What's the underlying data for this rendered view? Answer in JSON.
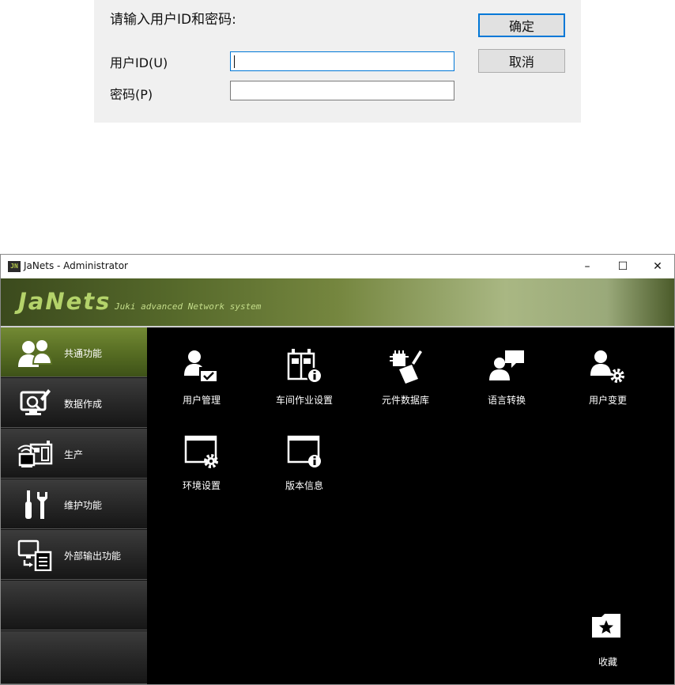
{
  "login": {
    "prompt": "请输入用户ID和密码:",
    "user_id_label": "用户ID(U)",
    "password_label": "密码(P)",
    "user_id_value": "",
    "password_value": "",
    "ok_label": "确定",
    "cancel_label": "取消"
  },
  "window": {
    "title": "JaNets - Administrator",
    "app_icon_text": "JN",
    "controls": {
      "minimize": "–",
      "maximize": "☐",
      "close": "✕"
    }
  },
  "banner": {
    "logo": "JaNets",
    "tagline": "Juki advanced Network system"
  },
  "sidebar": {
    "items": [
      {
        "label": "共通功能",
        "icon": "users-icon",
        "active": true
      },
      {
        "label": "数据作成",
        "icon": "data-edit-icon",
        "active": false
      },
      {
        "label": "生产",
        "icon": "production-icon",
        "active": false
      },
      {
        "label": "维护功能",
        "icon": "maintenance-tools-icon",
        "active": false
      },
      {
        "label": "外部输出功能",
        "icon": "export-icon",
        "active": false
      },
      {
        "label": "",
        "active": false
      },
      {
        "label": "",
        "active": false
      }
    ]
  },
  "tiles": [
    {
      "label": "用户管理",
      "icon": "user-management-icon"
    },
    {
      "label": "车间作业设置",
      "icon": "workshop-settings-icon"
    },
    {
      "label": "元件数据库",
      "icon": "component-database-icon"
    },
    {
      "label": "语言转换",
      "icon": "language-switch-icon"
    },
    {
      "label": "用户变更",
      "icon": "user-change-icon"
    },
    {
      "label": "环境设置",
      "icon": "environment-settings-icon"
    },
    {
      "label": "版本信息",
      "icon": "version-info-icon"
    }
  ],
  "favorites": {
    "label": "收藏",
    "icon": "favorites-folder-icon"
  },
  "colors": {
    "active_nav": "#5c7426",
    "accent_blue": "#0078d7",
    "logo": "#b4d36a"
  }
}
